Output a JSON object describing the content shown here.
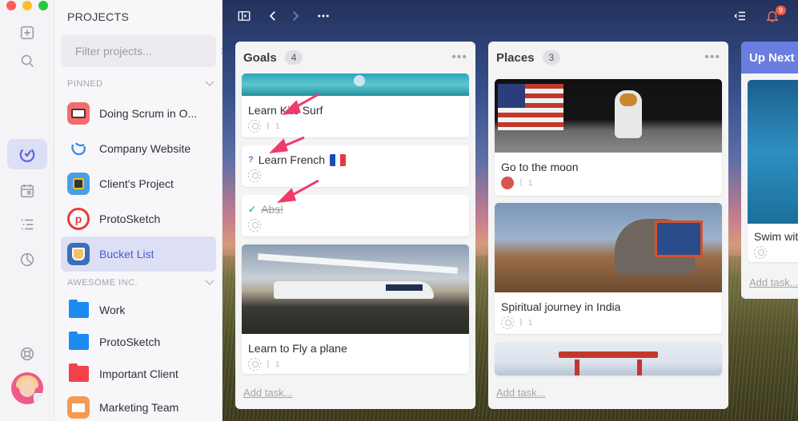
{
  "rail": {
    "colors": {
      "close": "#fe5f57",
      "minimize": "#febc2e",
      "zoom": "#28c840",
      "active_bg": "#dcdff5",
      "accent": "#5a67d8"
    }
  },
  "sidebar": {
    "title": "PROJECTS",
    "search_placeholder": "Filter projects...",
    "search_shortcut": "⌘P",
    "sections": [
      {
        "label": "PINNED",
        "projects": [
          {
            "label": "Doing Scrum in O...",
            "icon": "scrum-app-icon",
            "color": "#f26d6d"
          },
          {
            "label": "Company Website",
            "icon": "swirl-logo-icon",
            "color": "#3a8ee6"
          },
          {
            "label": "Client's Project",
            "icon": "robot-icon",
            "color": "#4a9fe4"
          },
          {
            "label": "ProtoSketch",
            "icon": "protosketch-logo-icon",
            "color": "#e63c3c"
          },
          {
            "label": "Bucket List",
            "icon": "bucket-icon",
            "color": "#3b6fb6",
            "active": true
          }
        ]
      },
      {
        "label": "AWESOME INC.",
        "projects": [
          {
            "label": "Work",
            "icon": "folder-icon",
            "color": "#1a8bf0"
          },
          {
            "label": "ProtoSketch",
            "icon": "folder-icon",
            "color": "#1a8bf0"
          },
          {
            "label": "Important Client",
            "icon": "folder-icon",
            "color": "#f2414a"
          },
          {
            "label": "Marketing Team",
            "icon": "presentation-icon",
            "color": "#f59a52"
          }
        ]
      }
    ]
  },
  "topbar": {
    "notifications_count": "9"
  },
  "columns": [
    {
      "title": "Goals",
      "count": "4",
      "add_task": "Add task...",
      "cards": [
        {
          "title": "Learn Kite Surf",
          "attachments": "1"
        },
        {
          "title": "Learn French",
          "prefix": "?",
          "prefix_color": "#9b59b6",
          "flag": "french-flag-icon"
        },
        {
          "title": "Abs!",
          "prefix": "✓",
          "prefix_color": "#2ecc71",
          "done": true
        },
        {
          "title": "Learn to Fly a plane",
          "attachments": "1"
        }
      ]
    },
    {
      "title": "Places",
      "count": "3",
      "add_task": "Add task...",
      "cards": [
        {
          "title": "Go to the moon",
          "attachments": "1"
        },
        {
          "title": "Spiritual journey in India",
          "attachments": "1"
        },
        {
          "title": ""
        }
      ]
    },
    {
      "title": "Up Next",
      "header_color": "#6a7de0",
      "add_task": "Add task...",
      "cards": [
        {
          "title": "Swim wit"
        }
      ]
    }
  ]
}
